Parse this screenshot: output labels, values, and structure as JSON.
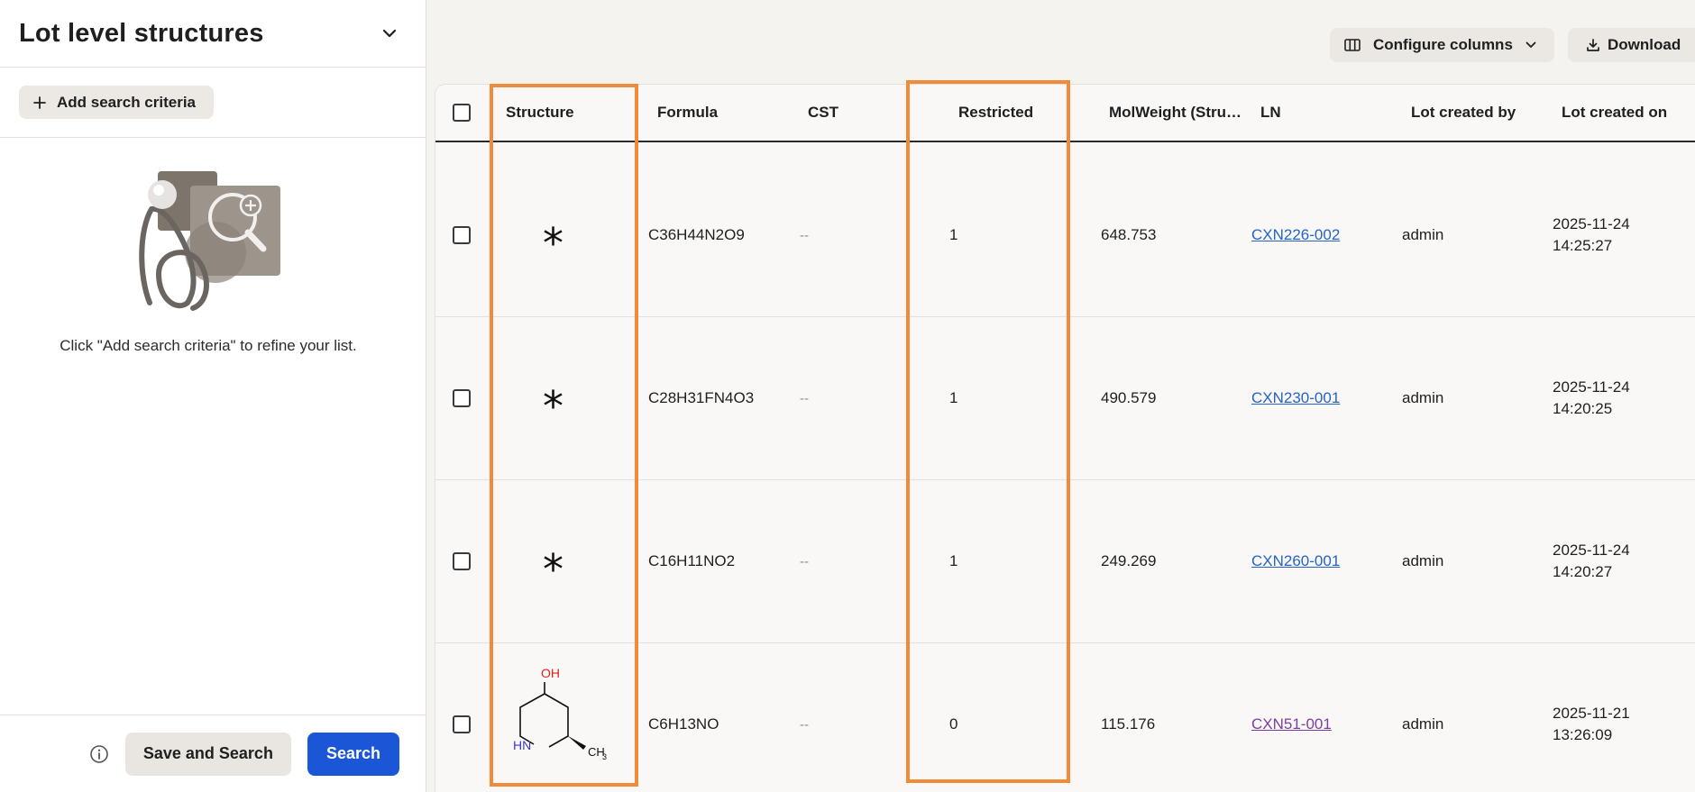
{
  "sidebar": {
    "title": "Lot level structures",
    "add_criteria_label": "Add search criteria",
    "empty_message": "Click \"Add search criteria\" to refine your list.",
    "save_and_search_label": "Save and Search",
    "search_label": "Search"
  },
  "toolbar": {
    "configure_columns_label": "Configure columns",
    "download_label": "Download"
  },
  "table": {
    "columns": [
      "Structure",
      "Formula",
      "CST",
      "Restricted",
      "MolWeight (Stru…",
      "LN",
      "Lot created by",
      "Lot created on"
    ],
    "rows": [
      {
        "structure": "*",
        "formula": "C36H44N2O9",
        "cst": "--",
        "restricted": "1",
        "molweight": "648.753",
        "ln": "CXN226-002",
        "created_by": "admin",
        "created_on": "2025-11-24\n14:25:27"
      },
      {
        "structure": "*",
        "formula": "C28H31FN4O3",
        "cst": "--",
        "restricted": "1",
        "molweight": "490.579",
        "ln": "CXN230-001",
        "created_by": "admin",
        "created_on": "2025-11-24\n14:20:25"
      },
      {
        "structure": "*",
        "formula": "C16H11NO2",
        "cst": "--",
        "restricted": "1",
        "molweight": "249.269",
        "ln": "CXN260-001",
        "created_by": "admin",
        "created_on": "2025-11-24\n14:20:27"
      },
      {
        "structure_labels": {
          "oh": "OH",
          "hn": "HN",
          "ch3": "CH",
          "ch3_sub": "3"
        },
        "formula": "C6H13NO",
        "cst": "--",
        "restricted": "0",
        "molweight": "115.176",
        "ln": "CXN51-001",
        "created_by": "admin",
        "created_on": "2025-11-21\n13:26:09"
      }
    ]
  },
  "colors": {
    "highlight": "#f08b3a",
    "primary_button": "#1a56d6",
    "link": "#2563c9",
    "visited_link": "#7b3fa3",
    "oh_label": "#e02020",
    "hn_label": "#3a3ac0"
  },
  "icons": [
    "chevron-down-icon",
    "plus-icon",
    "info-icon",
    "columns-icon",
    "download-icon",
    "search-illustration"
  ]
}
